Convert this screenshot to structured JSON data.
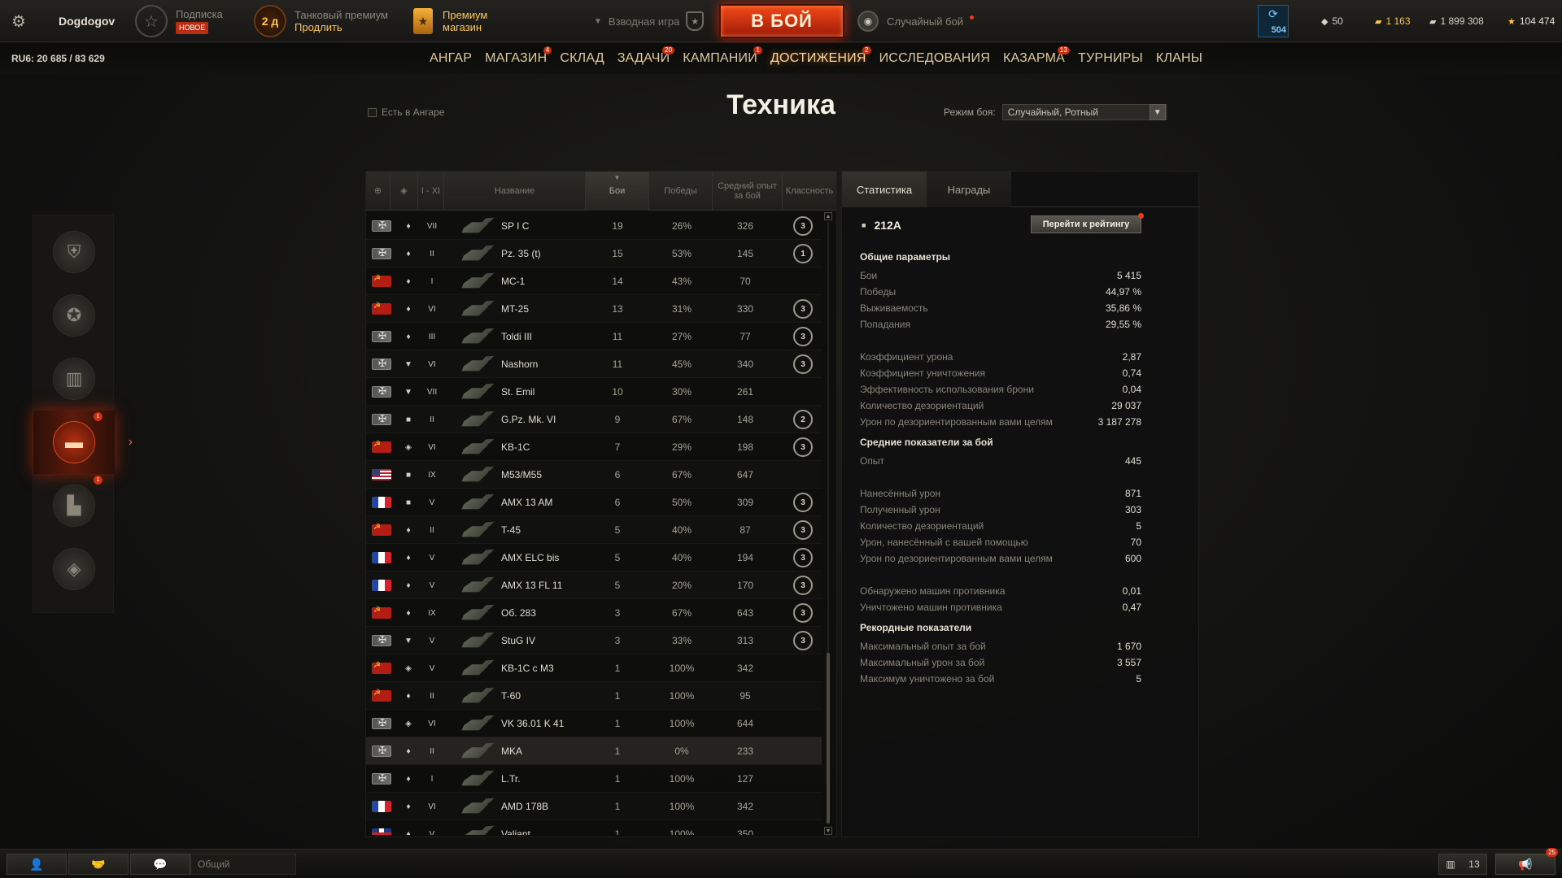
{
  "topbar": {
    "username": "Dogdogov",
    "subscription": {
      "label": "Подписка",
      "badge": "НОВОЕ"
    },
    "tank_premium": {
      "timer": "2 д",
      "title": "Танковый премиум",
      "action": "Продлить"
    },
    "premium_shop": {
      "line1": "Премиум",
      "line2": "магазин"
    },
    "platoon_label": "Взводная игра",
    "battle_button": "В БОЙ",
    "battle_mode": "Случайный бой",
    "xp_value": "504",
    "currencies": {
      "bonds": "50",
      "gold": "1 163",
      "credits": "1 899 308",
      "free_xp": "104 474"
    }
  },
  "navbar": {
    "rating": "RU6: 20 685 / 83 629",
    "items": [
      {
        "label": "АНГАР",
        "badge": ""
      },
      {
        "label": "МАГАЗИН",
        "badge": "4"
      },
      {
        "label": "СКЛАД",
        "badge": ""
      },
      {
        "label": "ЗАДАЧИ",
        "badge": "20"
      },
      {
        "label": "КАМПАНИИ",
        "badge": "1"
      },
      {
        "label": "ДОСТИЖЕНИЯ",
        "badge": "2"
      },
      {
        "label": "ИССЛЕДОВАНИЯ",
        "badge": ""
      },
      {
        "label": "КАЗАРМА",
        "badge": "13"
      },
      {
        "label": "ТУРНИРЫ",
        "badge": ""
      },
      {
        "label": "КЛАНЫ",
        "badge": ""
      }
    ],
    "active_index": 5
  },
  "page": {
    "title": "Техника",
    "in_hangar_label": "Есть в Ангаре",
    "battle_mode_label": "Режим боя:",
    "battle_mode_value": "Случайный, Ротный"
  },
  "table": {
    "headers": {
      "tier": "I - XI",
      "name": "Название",
      "battles": "Бои",
      "wins": "Победы",
      "avg_xp": "Средний опыт за бой",
      "mastery": "Классность"
    },
    "rows": [
      {
        "nation": "de",
        "type": "♦",
        "tier": "VII",
        "name": "SP I C",
        "battles": "19",
        "wins": "26%",
        "avg_xp": "326",
        "mastery": "3"
      },
      {
        "nation": "de",
        "type": "♦",
        "tier": "II",
        "name": "Pz. 35 (t)",
        "battles": "15",
        "wins": "53%",
        "avg_xp": "145",
        "mastery": "1"
      },
      {
        "nation": "su",
        "type": "♦",
        "tier": "I",
        "name": "MC-1",
        "battles": "14",
        "wins": "43%",
        "avg_xp": "70",
        "mastery": ""
      },
      {
        "nation": "su",
        "type": "♦",
        "tier": "VI",
        "name": "MT-25",
        "battles": "13",
        "wins": "31%",
        "avg_xp": "330",
        "mastery": "3"
      },
      {
        "nation": "de",
        "type": "♦",
        "tier": "III",
        "name": "Toldi III",
        "battles": "11",
        "wins": "27%",
        "avg_xp": "77",
        "mastery": "3"
      },
      {
        "nation": "de",
        "type": "▼",
        "tier": "VI",
        "name": "Nashorn",
        "battles": "11",
        "wins": "45%",
        "avg_xp": "340",
        "mastery": "3"
      },
      {
        "nation": "de",
        "type": "▼",
        "tier": "VII",
        "name": "St. Emil",
        "battles": "10",
        "wins": "30%",
        "avg_xp": "261",
        "mastery": ""
      },
      {
        "nation": "de",
        "type": "■",
        "tier": "II",
        "name": "G.Pz. Mk. VI",
        "battles": "9",
        "wins": "67%",
        "avg_xp": "148",
        "mastery": "2"
      },
      {
        "nation": "su",
        "type": "◈",
        "tier": "VI",
        "name": "KB-1C",
        "battles": "7",
        "wins": "29%",
        "avg_xp": "198",
        "mastery": "3"
      },
      {
        "nation": "us",
        "type": "■",
        "tier": "IX",
        "name": "M53/M55",
        "battles": "6",
        "wins": "67%",
        "avg_xp": "647",
        "mastery": ""
      },
      {
        "nation": "fr",
        "type": "■",
        "tier": "V",
        "name": "AMX 13 AM",
        "battles": "6",
        "wins": "50%",
        "avg_xp": "309",
        "mastery": "3"
      },
      {
        "nation": "su",
        "type": "♦",
        "tier": "II",
        "name": "T-45",
        "battles": "5",
        "wins": "40%",
        "avg_xp": "87",
        "mastery": "3"
      },
      {
        "nation": "fr",
        "type": "♦",
        "tier": "V",
        "name": "AMX ELC bis",
        "battles": "5",
        "wins": "40%",
        "avg_xp": "194",
        "mastery": "3"
      },
      {
        "nation": "fr",
        "type": "♦",
        "tier": "V",
        "name": "AMX 13 FL 11",
        "battles": "5",
        "wins": "20%",
        "avg_xp": "170",
        "mastery": "3"
      },
      {
        "nation": "su",
        "type": "♦",
        "tier": "IX",
        "name": "Об. 283",
        "battles": "3",
        "wins": "67%",
        "avg_xp": "643",
        "mastery": "3"
      },
      {
        "nation": "de",
        "type": "▼",
        "tier": "V",
        "name": "StuG IV",
        "battles": "3",
        "wins": "33%",
        "avg_xp": "313",
        "mastery": "3"
      },
      {
        "nation": "su",
        "type": "◈",
        "tier": "V",
        "name": "KB-1C с M3",
        "battles": "1",
        "wins": "100%",
        "avg_xp": "342",
        "mastery": ""
      },
      {
        "nation": "su",
        "type": "♦",
        "tier": "II",
        "name": "T-60",
        "battles": "1",
        "wins": "100%",
        "avg_xp": "95",
        "mastery": ""
      },
      {
        "nation": "de",
        "type": "◈",
        "tier": "VI",
        "name": "VK 36.01 K 41",
        "battles": "1",
        "wins": "100%",
        "avg_xp": "644",
        "mastery": ""
      },
      {
        "nation": "de",
        "type": "♦",
        "tier": "II",
        "name": "MKA",
        "battles": "1",
        "wins": "0%",
        "avg_xp": "233",
        "mastery": ""
      },
      {
        "nation": "de",
        "type": "♦",
        "tier": "I",
        "name": "L.Tr.",
        "battles": "1",
        "wins": "100%",
        "avg_xp": "127",
        "mastery": ""
      },
      {
        "nation": "fr",
        "type": "♦",
        "tier": "VI",
        "name": "AMD 178B",
        "battles": "1",
        "wins": "100%",
        "avg_xp": "342",
        "mastery": ""
      },
      {
        "nation": "uk",
        "type": "♦",
        "tier": "V",
        "name": "Valiant",
        "battles": "1",
        "wins": "100%",
        "avg_xp": "350",
        "mastery": ""
      }
    ]
  },
  "stats": {
    "tabs": [
      "Статистика",
      "Награды"
    ],
    "vehicle": "212A",
    "rating_button": "Перейти к рейтингу",
    "general": {
      "title": "Общие параметры",
      "rows": [
        {
          "label": "Бои",
          "value": "5 415"
        },
        {
          "label": "Победы",
          "value": "44,97 %"
        },
        {
          "label": "Выживаемость",
          "value": "35,86 %"
        },
        {
          "label": "Попадания",
          "value": "29,55 %"
        }
      ],
      "rows2": [
        {
          "label": "Коэффициент урона",
          "value": "2,87"
        },
        {
          "label": "Коэффициент уничтожения",
          "value": "0,74"
        },
        {
          "label": "Эффективность использования брони",
          "value": "0,04"
        },
        {
          "label": "Количество дезориентаций",
          "value": "29 037"
        },
        {
          "label": "Урон по дезориентированным вами целям",
          "value": "3 187 278"
        }
      ]
    },
    "average": {
      "title": "Средние показатели за бой",
      "rows": [
        {
          "label": "Опыт",
          "value": "445"
        }
      ],
      "rows2": [
        {
          "label": "Нанесённый урон",
          "value": "871"
        },
        {
          "label": "Полученный урон",
          "value": "303"
        },
        {
          "label": "Количество дезориентаций",
          "value": "5"
        },
        {
          "label": "Урон, нанесённый с вашей помощью",
          "value": "70"
        },
        {
          "label": "Урон по дезориентированным вами целям",
          "value": "600"
        }
      ],
      "rows3": [
        {
          "label": "Обнаружено машин противника",
          "value": "0,01"
        },
        {
          "label": "Уничтожено машин противника",
          "value": "0,47"
        }
      ]
    },
    "records": {
      "title": "Рекордные показатели",
      "rows": [
        {
          "label": "Максимальный опыт за бой",
          "value": "1 670"
        },
        {
          "label": "Максимальный урон за бой",
          "value": "3 557"
        },
        {
          "label": "Максимум уничтожено за бой",
          "value": "5"
        }
      ]
    }
  },
  "bottombar": {
    "chat_channel": "Общий",
    "sessions_count": "13",
    "notifications_badge": "25"
  },
  "sidebar_badges": {
    "vehicles": "1",
    "ranks": "1"
  }
}
